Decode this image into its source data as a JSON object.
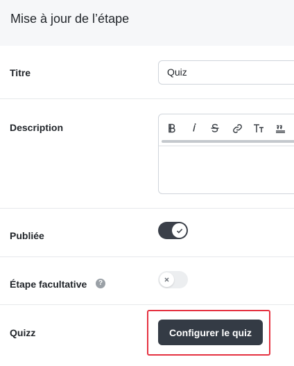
{
  "header": {
    "title": "Mise à jour de l’étape"
  },
  "fields": {
    "title": {
      "label": "Titre",
      "value": "Quiz"
    },
    "description": {
      "label": "Description",
      "toolbar": [
        "bold-icon",
        "italic-icon",
        "strikethrough-icon",
        "link-icon",
        "text-size-icon",
        "quote-icon"
      ]
    },
    "published": {
      "label": "Publiée",
      "checked": true
    },
    "optional": {
      "label": "Étape facultative",
      "help": "?",
      "checked": false
    },
    "quiz": {
      "label": "Quizz",
      "button_label": "Configurer le quiz"
    }
  },
  "colors": {
    "primary": "#343b45",
    "highlight": "#e5303f",
    "header_bg": "#f6f7f9"
  }
}
